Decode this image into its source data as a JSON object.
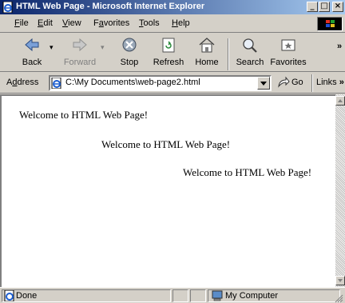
{
  "window": {
    "title": "HTML Web Page - Microsoft Internet Explorer",
    "buttons": {
      "minimize": "_",
      "maximize": "□",
      "close": "×"
    }
  },
  "menu": [
    {
      "accel": "F",
      "rest": "ile"
    },
    {
      "accel": "E",
      "rest": "dit"
    },
    {
      "accel": "V",
      "rest": "iew"
    },
    {
      "pre": "F",
      "accel": "a",
      "rest": "vorites"
    },
    {
      "accel": "T",
      "rest": "ools"
    },
    {
      "accel": "H",
      "rest": "elp"
    }
  ],
  "toolbar": {
    "back": "Back",
    "forward": "Forward",
    "stop": "Stop",
    "refresh": "Refresh",
    "home": "Home",
    "search": "Search",
    "favorites": "Favorites",
    "more": "»"
  },
  "address": {
    "label_pre": "A",
    "label_accel": "d",
    "label_rest": "dress",
    "value": "C:\\My Documents\\web-page2.html",
    "go": "Go",
    "links": "Links",
    "links_more": "»"
  },
  "page": {
    "lines": [
      "Welcome to HTML Web Page!",
      "Welcome to HTML Web Page!",
      "Welcome to HTML Web Page!"
    ]
  },
  "status": {
    "text": "Done",
    "zone": "My Computer"
  },
  "icons": {
    "title": "ie-page-icon",
    "address": "ie-page-icon",
    "zone": "my-computer-icon",
    "status": "ie-page-icon"
  },
  "colors": {
    "titlebar_start": "#0a246a",
    "titlebar_end": "#a6caf0",
    "chrome": "#d4d0c8",
    "content_bg": "#ffffff"
  }
}
